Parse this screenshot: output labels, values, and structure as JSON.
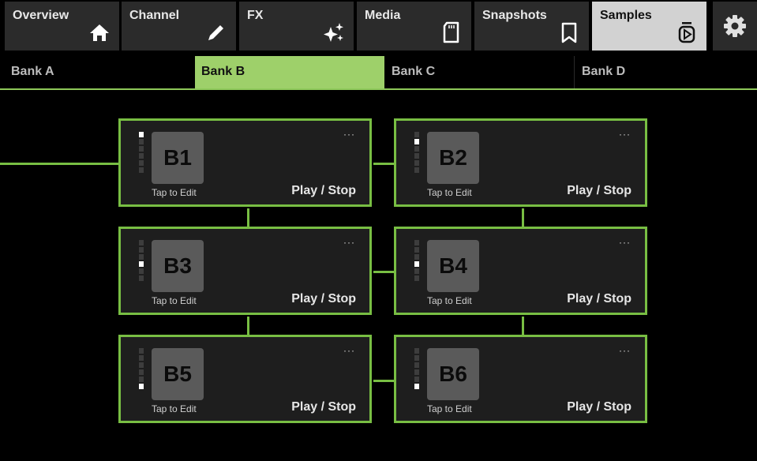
{
  "tabs": [
    {
      "label": "Overview",
      "icon": "home-icon"
    },
    {
      "label": "Channel",
      "icon": "pencil-icon"
    },
    {
      "label": "FX",
      "icon": "sparkles-icon"
    },
    {
      "label": "Media",
      "icon": "sd-card-icon"
    },
    {
      "label": "Snapshots",
      "icon": "bookmark-icon"
    },
    {
      "label": "Samples",
      "icon": "sample-player-icon",
      "active": true
    }
  ],
  "settings_icon": "gear-icon",
  "banks": [
    {
      "label": "Bank A"
    },
    {
      "label": "Bank B",
      "active": true
    },
    {
      "label": "Bank C"
    },
    {
      "label": "Bank D"
    }
  ],
  "samples": [
    {
      "name": "B1",
      "edit_label": "Tap to Edit",
      "action_label": "Play / Stop",
      "menu": "···",
      "meter_level": 6
    },
    {
      "name": "B2",
      "edit_label": "Tap to Edit",
      "action_label": "Play / Stop",
      "menu": "···",
      "meter_level": 5
    },
    {
      "name": "B3",
      "edit_label": "Tap to Edit",
      "action_label": "Play / Stop",
      "menu": "···",
      "meter_level": 3
    },
    {
      "name": "B4",
      "edit_label": "Tap to Edit",
      "action_label": "Play / Stop",
      "menu": "···",
      "meter_level": 3
    },
    {
      "name": "B5",
      "edit_label": "Tap to Edit",
      "action_label": "Play / Stop",
      "menu": "···",
      "meter_level": 1
    },
    {
      "name": "B6",
      "edit_label": "Tap to Edit",
      "action_label": "Play / Stop",
      "menu": "···",
      "meter_level": 1
    }
  ],
  "colors": {
    "accent": "#78be43",
    "active_bank": "#9ed06a",
    "active_tab": "#d2d2d2"
  }
}
